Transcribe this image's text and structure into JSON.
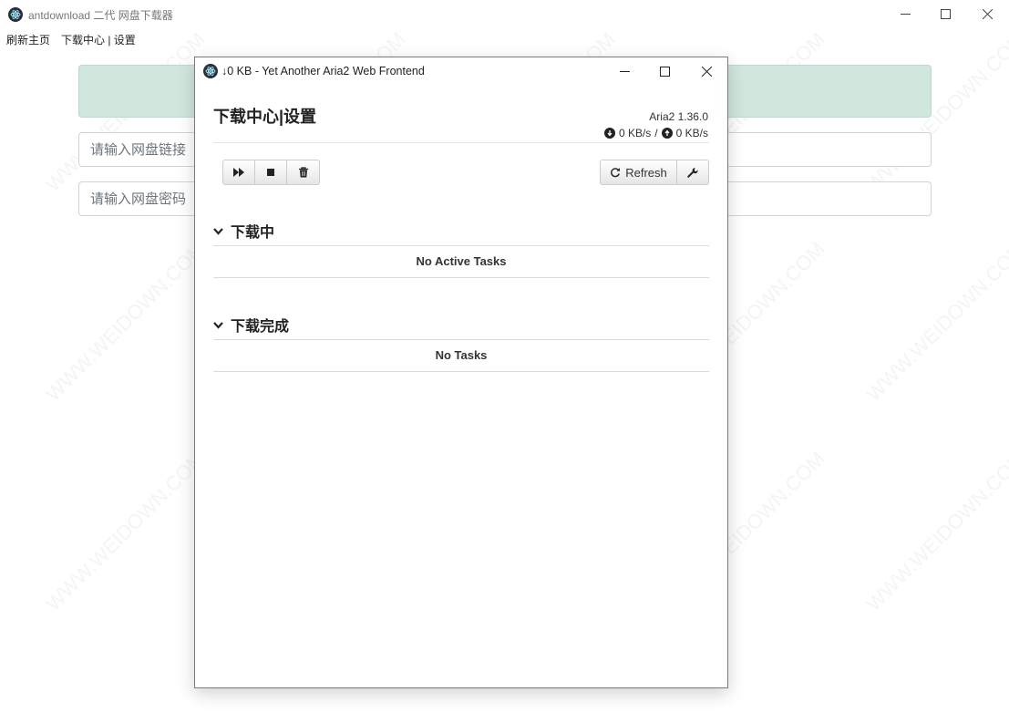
{
  "main_window": {
    "title": "antdownload 二代 网盘下载器",
    "menu": [
      "刷新主页",
      "下载中心 | 设置"
    ],
    "link_input_placeholder": "请输入网盘链接",
    "password_input_placeholder": "请输入网盘密码"
  },
  "dialog": {
    "title": "↓0 KB - Yet Another Aria2 Web Frontend",
    "heading": "下载中心|设置",
    "version": "Aria2 1.36.0",
    "download_speed": "0 KB/s",
    "speed_separator": "/",
    "upload_speed": "0 KB/s",
    "refresh_label": "Refresh",
    "sections": [
      {
        "title": "下载中",
        "empty_text": "No Active Tasks"
      },
      {
        "title": "下载完成",
        "empty_text": "No Tasks"
      }
    ]
  },
  "watermark_text": "WWW.WEIDOWN.COM",
  "colors": {
    "banner_bg": "#d1e7dd",
    "banner_border": "#badbcc",
    "icon_dark": "#2b2e3b"
  },
  "icons": [
    "electron-icon",
    "minimize-icon",
    "maximize-icon",
    "close-icon",
    "play-forward-icon",
    "stop-icon",
    "trash-icon",
    "refresh-icon",
    "wrench-icon",
    "chevron-down-icon",
    "arrow-down-circle-icon",
    "arrow-up-circle-icon"
  ]
}
